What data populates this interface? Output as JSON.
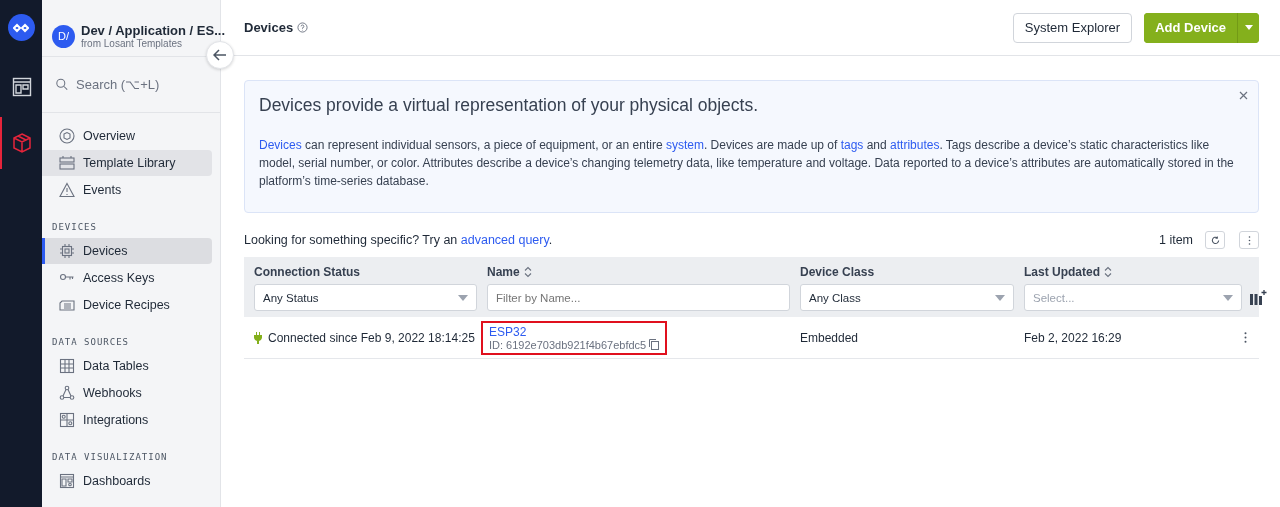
{
  "rail": {
    "items": [
      {
        "selected": false
      },
      {
        "selected": true
      }
    ]
  },
  "sidebar": {
    "app": {
      "avatar": "D/",
      "title": "Dev / Application / ES...",
      "subtitle": "from Losant Templates"
    },
    "search": {
      "placeholder": "Search (⌥+L)"
    },
    "sections": [
      {
        "items": [
          {
            "label": "Overview",
            "selected": false,
            "hovered": false
          },
          {
            "label": "Template Library",
            "selected": false,
            "hovered": true
          },
          {
            "label": "Events",
            "selected": false,
            "hovered": false
          }
        ]
      },
      {
        "heading": "DEVICES",
        "items": [
          {
            "label": "Devices",
            "selected": true,
            "hovered": false
          },
          {
            "label": "Access Keys",
            "selected": false,
            "hovered": false
          },
          {
            "label": "Device Recipes",
            "selected": false,
            "hovered": false
          }
        ]
      },
      {
        "heading": "DATA SOURCES",
        "items": [
          {
            "label": "Data Tables",
            "selected": false,
            "hovered": false
          },
          {
            "label": "Webhooks",
            "selected": false,
            "hovered": false
          },
          {
            "label": "Integrations",
            "selected": false,
            "hovered": false
          }
        ]
      },
      {
        "heading": "DATA VISUALIZATION",
        "items": [
          {
            "label": "Dashboards",
            "selected": false,
            "hovered": false
          }
        ]
      }
    ]
  },
  "header": {
    "title": "Devices",
    "buttons": [
      {
        "label": "System Explorer",
        "kind": "secondary"
      },
      {
        "label": "Add Device",
        "kind": "primary"
      }
    ]
  },
  "info": {
    "title": "Devices provide a virtual representation of your physical objects.",
    "body": [
      {
        "text": "Devices",
        "link": true
      },
      {
        "text": " can represent individual sensors, a piece of equipment, or an entire ",
        "link": false
      },
      {
        "text": "system",
        "link": true
      },
      {
        "text": ". Devices are made up of ",
        "link": false
      },
      {
        "text": "tags",
        "link": true
      },
      {
        "text": " and ",
        "link": false
      },
      {
        "text": "attributes",
        "link": true
      },
      {
        "text": ". Tags describe a device’s static characteristics like model, serial number, or color. Attributes describe a device’s changing telemetry data, like temperature and voltage. Data reported to a device’s attributes are automatically stored in the platform’s time-series database.",
        "link": false
      }
    ]
  },
  "query": {
    "prefix": "Looking for something specific? Try an ",
    "link": "advanced query",
    "suffix": "."
  },
  "count": "1 item",
  "table": {
    "columns": [
      {
        "label": "Connection Status",
        "sortable": false,
        "filter": {
          "kind": "select",
          "value": "Any Status"
        }
      },
      {
        "label": "Name",
        "sortable": true,
        "filter": {
          "kind": "input",
          "placeholder": "Filter by Name..."
        }
      },
      {
        "label": "Device Class",
        "sortable": false,
        "filter": {
          "kind": "select",
          "value": "Any Class"
        }
      },
      {
        "label": "Last Updated",
        "sortable": true,
        "filter": {
          "kind": "select",
          "placeholder": "Select..."
        }
      }
    ],
    "rows": [
      {
        "status": "Connected since Feb 9, 2022 18:14:25",
        "connected": true,
        "name": "ESP32",
        "id": "ID: 6192e703db921f4b67ebfdc5",
        "highlighted": true,
        "device_class": "Embedded",
        "updated": "Feb 2, 2022 16:29"
      }
    ]
  }
}
